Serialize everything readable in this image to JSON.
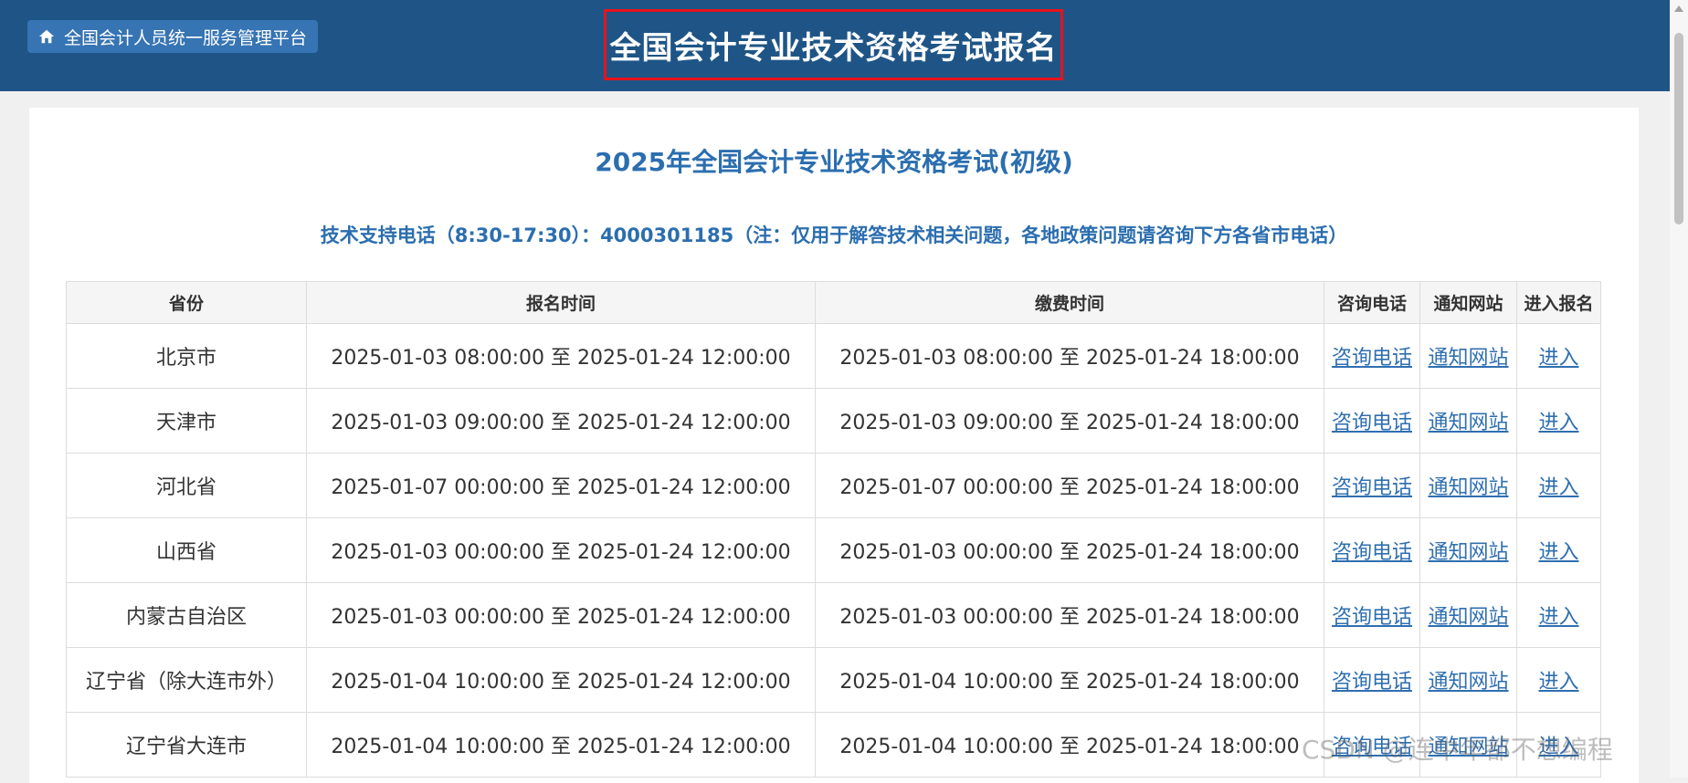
{
  "header": {
    "home_label": "全国会计人员统一服务管理平台",
    "page_title": "全国会计专业技术资格考试报名",
    "bg_color": "#1f5586",
    "highlight_color": "#e8131b"
  },
  "main": {
    "subtitle": "2025年全国会计专业技术资格考试(初级)",
    "support_text": "技术支持电话（8:30-17:30）：4000301185（注：仅用于解答技术相关问题，各地政策问题请咨询下方各省市电话）",
    "accent_color": "#2b6eaf"
  },
  "table": {
    "columns": [
      "省份",
      "报名时间",
      "缴费时间",
      "咨询电话",
      "通知网站",
      "进入报名"
    ],
    "rows": [
      {
        "province": "北京市",
        "reg_time": "2025-01-03 08:00:00 至 2025-01-24 12:00:00",
        "pay_time": "2025-01-03 08:00:00 至 2025-01-24 18:00:00",
        "phone": "咨询电话",
        "site": "通知网站",
        "enter": "进入"
      },
      {
        "province": "天津市",
        "reg_time": "2025-01-03 09:00:00 至 2025-01-24 12:00:00",
        "pay_time": "2025-01-03 09:00:00 至 2025-01-24 18:00:00",
        "phone": "咨询电话",
        "site": "通知网站",
        "enter": "进入"
      },
      {
        "province": "河北省",
        "reg_time": "2025-01-07 00:00:00 至 2025-01-24 12:00:00",
        "pay_time": "2025-01-07 00:00:00 至 2025-01-24 18:00:00",
        "phone": "咨询电话",
        "site": "通知网站",
        "enter": "进入"
      },
      {
        "province": "山西省",
        "reg_time": "2025-01-03 00:00:00 至 2025-01-24 12:00:00",
        "pay_time": "2025-01-03 00:00:00 至 2025-01-24 18:00:00",
        "phone": "咨询电话",
        "site": "通知网站",
        "enter": "进入"
      },
      {
        "province": "内蒙古自治区",
        "reg_time": "2025-01-03 00:00:00 至 2025-01-24 12:00:00",
        "pay_time": "2025-01-03 00:00:00 至 2025-01-24 18:00:00",
        "phone": "咨询电话",
        "site": "通知网站",
        "enter": "进入"
      },
      {
        "province": "辽宁省（除大连市外）",
        "reg_time": "2025-01-04 10:00:00 至 2025-01-24 12:00:00",
        "pay_time": "2025-01-04 10:00:00 至 2025-01-24 18:00:00",
        "phone": "咨询电话",
        "site": "通知网站",
        "enter": "进入"
      },
      {
        "province": "辽宁省大连市",
        "reg_time": "2025-01-04 10:00:00 至 2025-01-24 12:00:00",
        "pay_time": "2025-01-04 10:00:00 至 2025-01-24 18:00:00",
        "phone": "咨询电话",
        "site": "通知网站",
        "enter": "进入"
      }
    ]
  },
  "watermark": "CSDN @连中年都不想编程",
  "icons": {
    "home": "home-icon"
  }
}
